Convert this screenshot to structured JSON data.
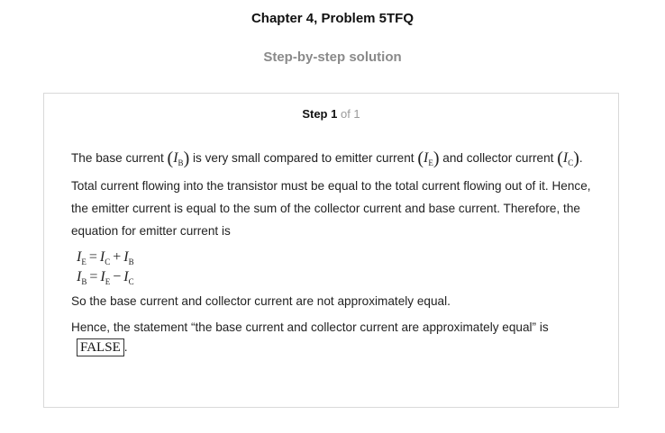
{
  "header": {
    "title": "Chapter 4, Problem 5TFQ",
    "subtitle": "Step-by-step solution"
  },
  "step": {
    "label": "Step 1",
    "of": "of 1"
  },
  "solution": {
    "intro_1": "The base current ",
    "intro_2": " is very small compared to emitter current ",
    "intro_3": " and collector current ",
    "intro_4": ". Total current flowing into the transistor must be equal to the total current flowing out of it. Hence, the emitter current is equal to the sum of the collector current and base current. Therefore, the equation for emitter current is",
    "symbols": {
      "I": "I",
      "B": "B",
      "E": "E",
      "C": "C",
      "lparen": "(",
      "rparen": ")",
      "eq": "=",
      "plus": "+",
      "minus": "−"
    },
    "conclusion": "So the base current and collector current are not approximately equal.",
    "statement": "Hence, the statement “the base current and collector current are approximately equal” is",
    "answer": "FALSE",
    "period": "."
  }
}
